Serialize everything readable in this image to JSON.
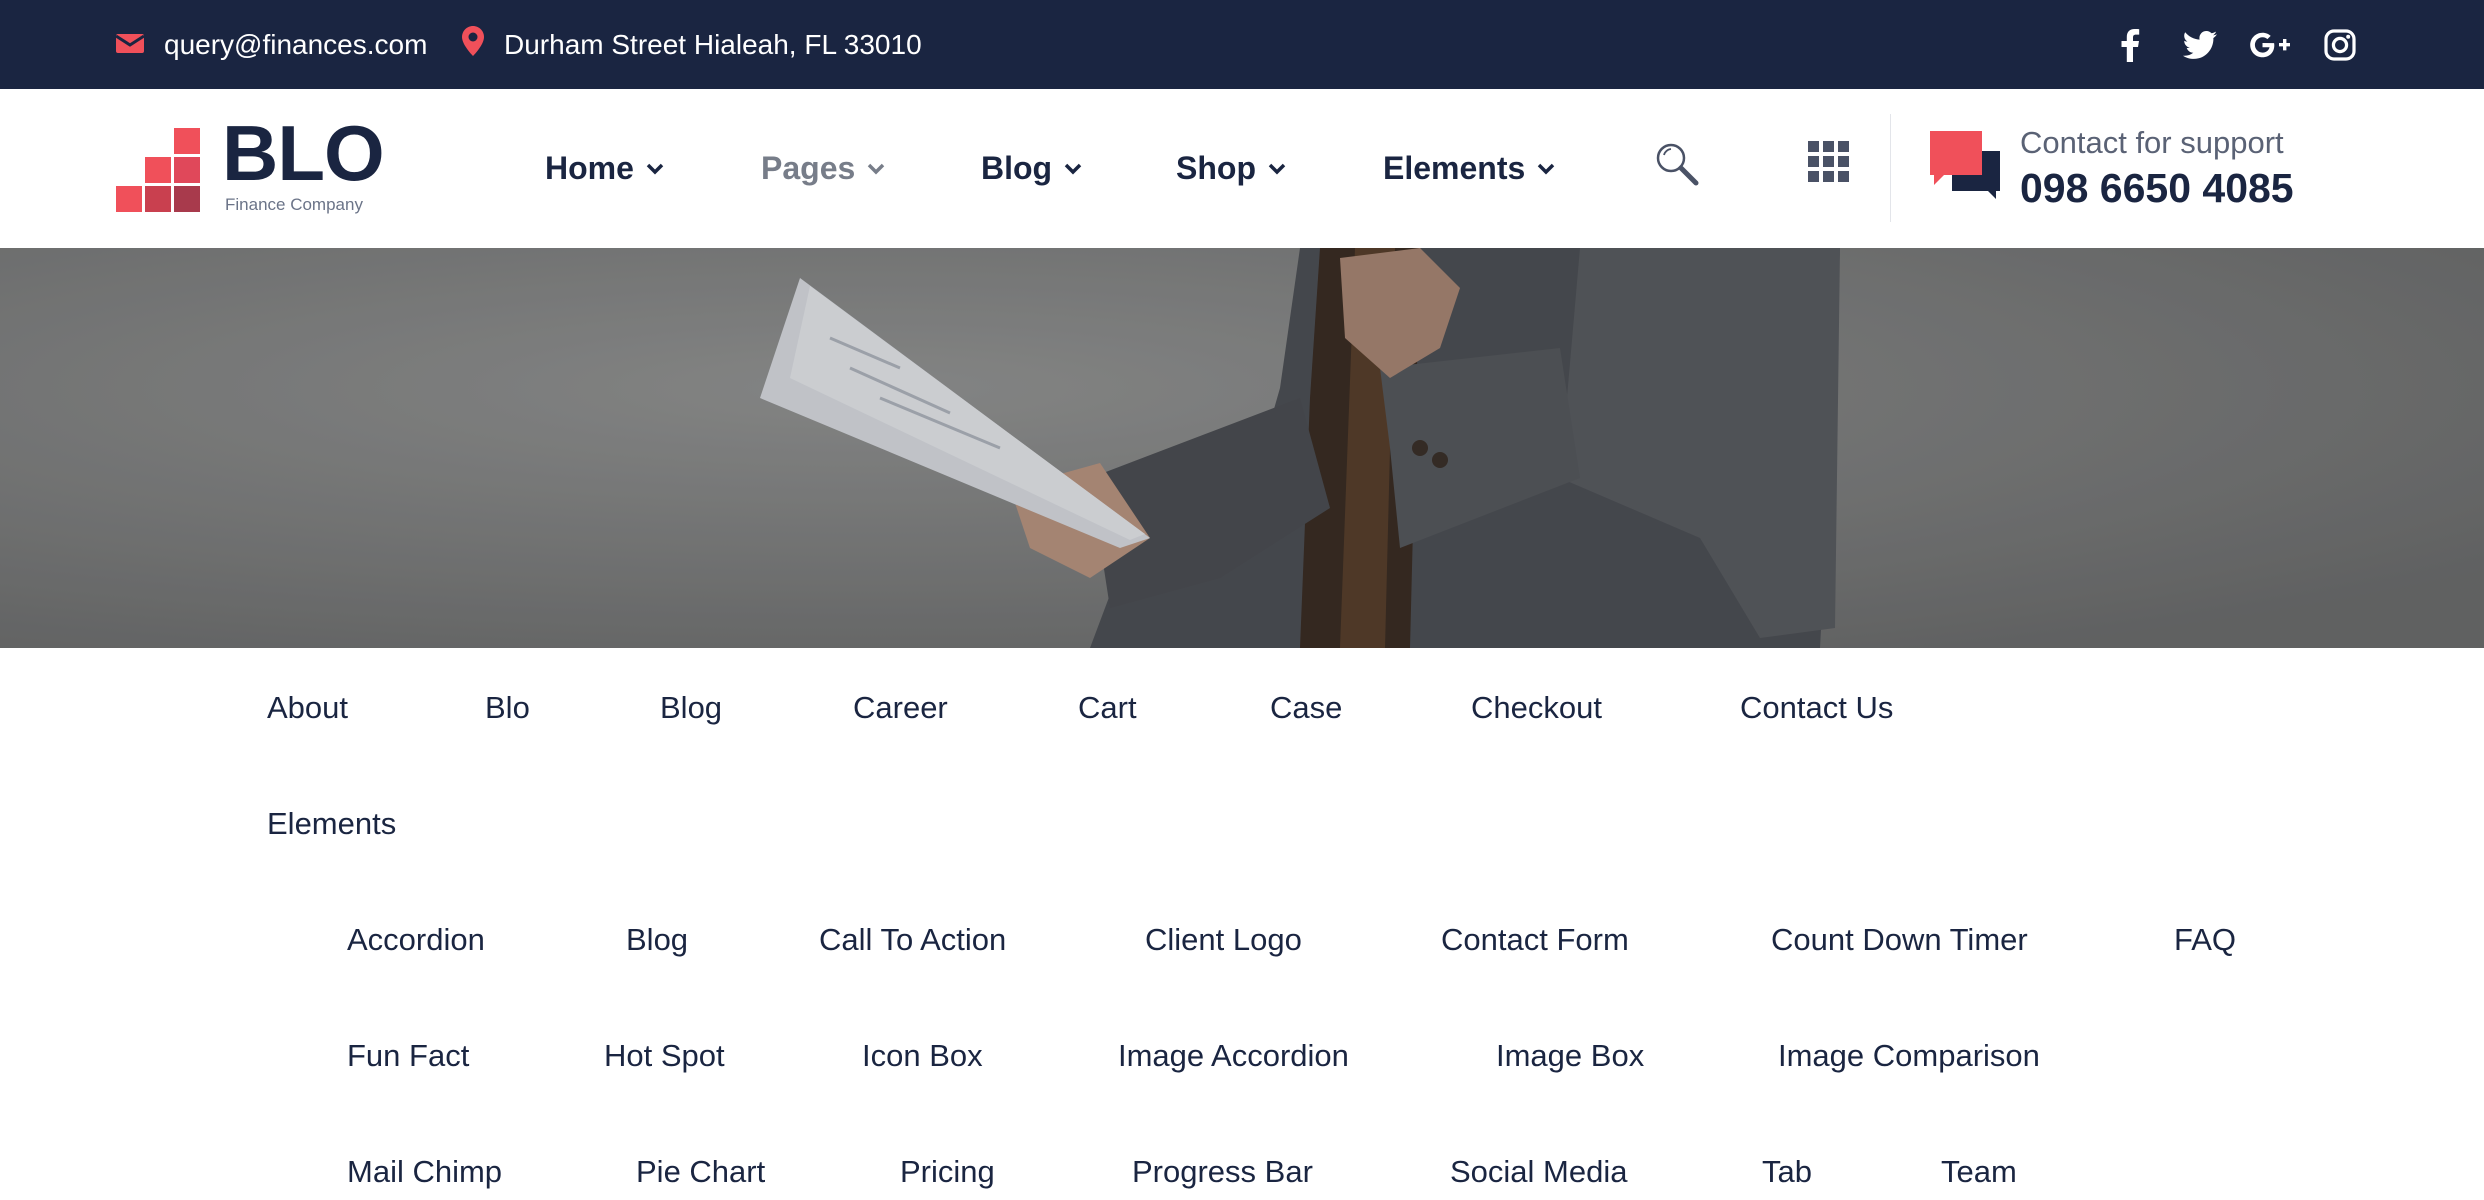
{
  "topbar": {
    "email": "query@finances.com",
    "address": "Durham Street Hialeah, FL 33010",
    "socials": [
      "facebook-icon",
      "twitter-icon",
      "google-plus-icon",
      "instagram-icon"
    ]
  },
  "header": {
    "logo_word": "BLO",
    "logo_tagline": "Finance Company",
    "nav": [
      "Home",
      "Pages",
      "Blog",
      "Shop",
      "Elements"
    ],
    "active_nav": "Pages",
    "support_label": "Contact for support",
    "support_phone": "098 6650 4085"
  },
  "pages_menu": {
    "row1": [
      "About",
      "Blo",
      "Blog",
      "Career",
      "Cart",
      "Case",
      "Checkout",
      "Contact Us"
    ],
    "row2": [
      "Elements"
    ],
    "elements_submenu": {
      "row1": [
        "Accordion",
        "Blog",
        "Call To Action",
        "Client Logo",
        "Contact Form",
        "Count Down Timer",
        "FAQ"
      ],
      "row2": [
        "Fun Fact",
        "Hot Spot",
        "Icon Box",
        "Image Accordion",
        "Image Box",
        "Image Comparison"
      ],
      "row3": [
        "Mail Chimp",
        "Pie Chart",
        "Pricing",
        "Progress Bar",
        "Social Media",
        "Tab",
        "Team"
      ]
    }
  },
  "colors": {
    "navy": "#1a2541",
    "accent": "#f0505a",
    "muted": "#777d89"
  }
}
